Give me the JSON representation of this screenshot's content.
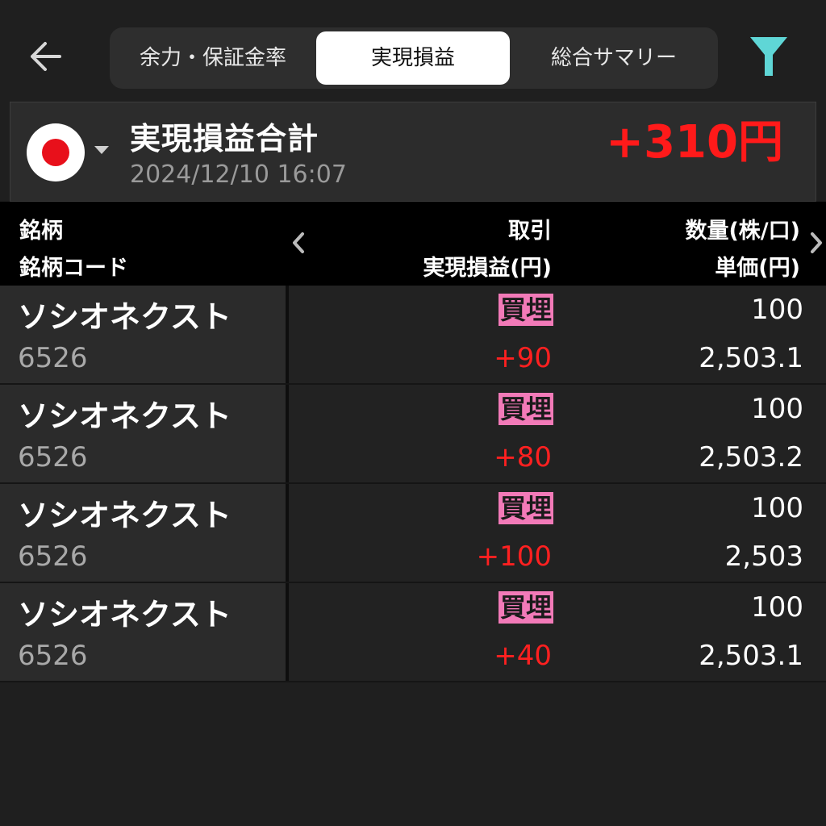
{
  "tabs": [
    {
      "label": "余力・保証金率"
    },
    {
      "label": "実現損益"
    },
    {
      "label": "総合サマリー"
    }
  ],
  "active_tab": "実現損益",
  "summary": {
    "title": "実現損益合計",
    "datetime": "2024/12/10 16:07",
    "total": "+310円"
  },
  "columns": {
    "col1_line1": "銘柄",
    "col1_line2": "銘柄コード",
    "col2_line1": "取引",
    "col2_line2": "実現損益(円)",
    "col3_line1": "数量(株/口)",
    "col3_line2": "単価(円)"
  },
  "rows": [
    {
      "name": "ソシオネクスト",
      "code": "6526",
      "trade": "買埋",
      "pl": "+90",
      "qty": "100",
      "price": "2,503.1"
    },
    {
      "name": "ソシオネクスト",
      "code": "6526",
      "trade": "買埋",
      "pl": "+80",
      "qty": "100",
      "price": "2,503.2"
    },
    {
      "name": "ソシオネクスト",
      "code": "6526",
      "trade": "買埋",
      "pl": "+100",
      "qty": "100",
      "price": "2,503"
    },
    {
      "name": "ソシオネクスト",
      "code": "6526",
      "trade": "買埋",
      "pl": "+40",
      "qty": "100",
      "price": "2,503.1"
    }
  ],
  "icons": {
    "back": "arrow-left-icon",
    "filter": "filter-icon",
    "flag": "japan-flag-icon",
    "prev": "chevron-left-icon",
    "next": "chevron-right-icon"
  },
  "colors": {
    "profit": "#ff1a1a",
    "trade_badge": "#f27ab8",
    "filter": "#5fd6d6"
  }
}
